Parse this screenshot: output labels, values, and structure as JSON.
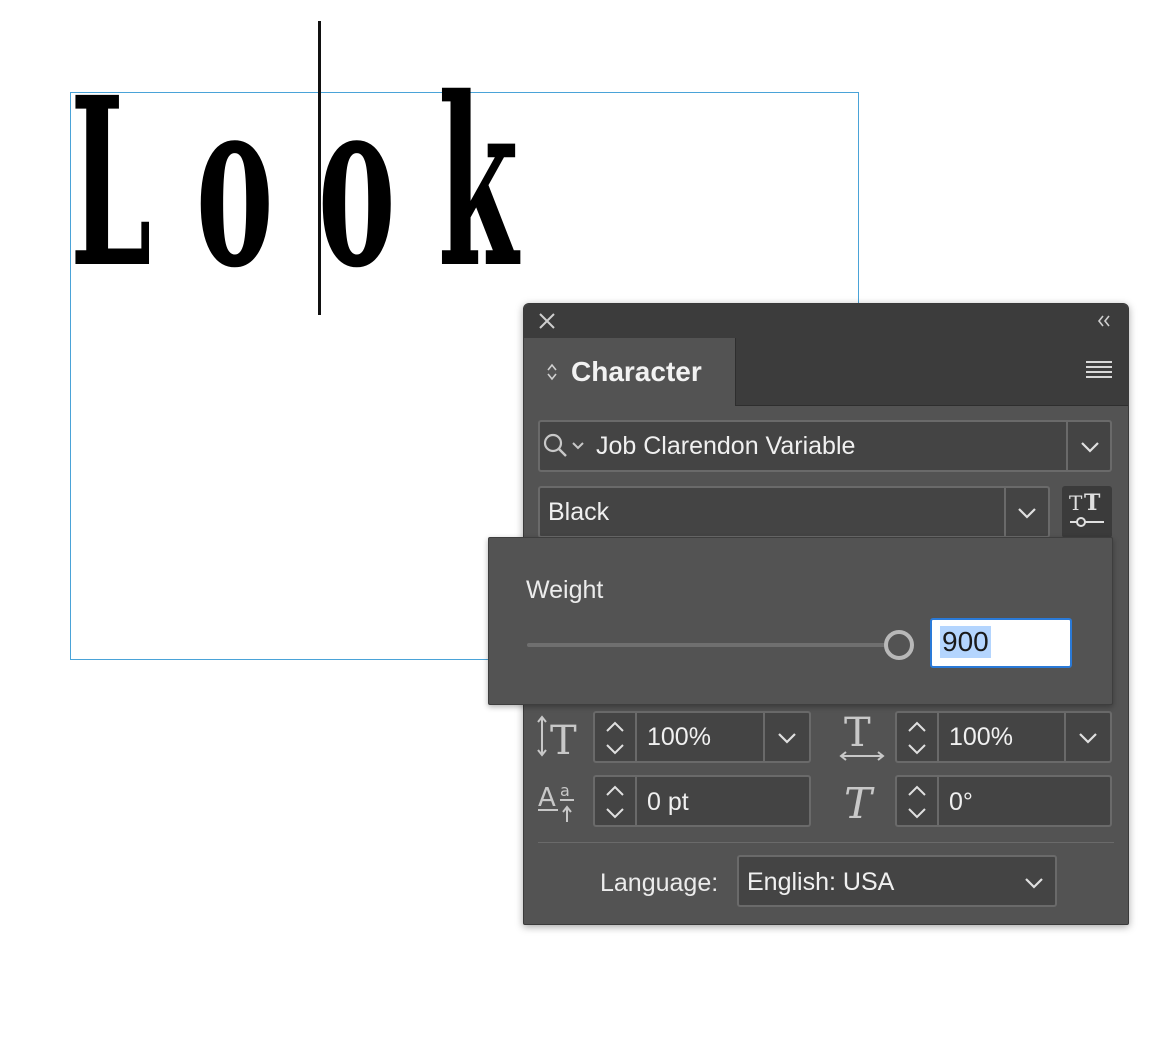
{
  "canvas": {
    "letters": [
      "L",
      "o",
      "o",
      "k"
    ]
  },
  "panel": {
    "tab_label": "Character",
    "font_family": "Job Clarendon Variable",
    "font_style": "Black",
    "weight_popup": {
      "label": "Weight",
      "value": "900",
      "slider_fraction": 1.0
    },
    "vertical_scale": "100%",
    "horizontal_scale": "100%",
    "baseline_shift": "0 pt",
    "skew": "0°",
    "language_label": "Language:",
    "language_value": "English: USA"
  },
  "icons": {
    "close": "close-icon",
    "collapse": "collapse-icon",
    "panel_menu": "hamburger-menu-icon",
    "font_search": "search-icon",
    "variable_font": "variable-font-icon",
    "vertical_scale": "vertical-scale-icon",
    "horizontal_scale": "horizontal-scale-icon",
    "baseline_shift": "baseline-shift-icon",
    "skew": "skew-icon"
  },
  "colors": {
    "panel_bg": "#535353",
    "titlebar_bg": "#3c3c3c",
    "frame_border": "#4aa3d8",
    "input_focus": "#2a7ad8",
    "selection": "#b4d5fe"
  }
}
